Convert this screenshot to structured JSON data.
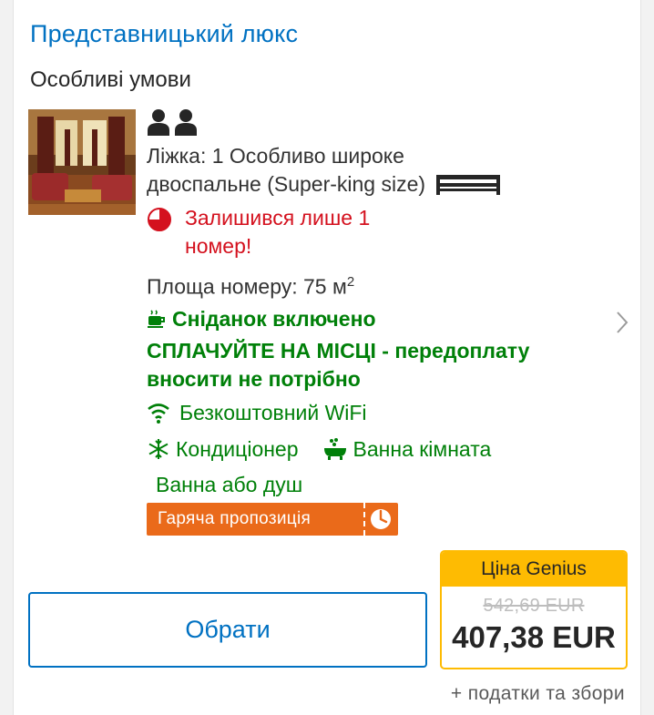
{
  "room": {
    "title": "Представницький люкс",
    "conditions": "Особливі умови",
    "beds_line1": "Ліжка: 1 Особливо широке",
    "beds_line2": "двоспальне (Super-king size)",
    "scarcity_line1": "Залишився лише 1",
    "scarcity_line2": "номер!",
    "area_label": "Площа номеру: 75 м",
    "area_sup": "2",
    "breakfast": "Сніданок включено",
    "pay_line1": "СПЛАЧУЙТЕ НА МІСЦІ - передоплату",
    "pay_line2": "вносити не потрібно",
    "wifi": "Безкоштовний WiFi",
    "ac": "Кондиціонер",
    "bathroom": "Ванна кімната",
    "bath_or_shower": "Ванна або душ",
    "hot_deal": "Гаряча пропозиція"
  },
  "action": {
    "select_label": "Обрати"
  },
  "price": {
    "genius_label": "Ціна Genius",
    "old_price": "542,69 EUR",
    "new_price": "407,38 EUR",
    "taxes": "+ податки та збори"
  },
  "colors": {
    "brand_blue": "#0071c2",
    "green": "#008009",
    "red": "#d4111e",
    "genius_yellow": "#febb02",
    "hot_orange": "#ea6a1a"
  },
  "icons": [
    "person-icon",
    "bed-icon",
    "clock-icon",
    "coffee-cup-icon",
    "wifi-icon",
    "snowflake-icon",
    "bathtub-icon",
    "hot-deal-clock-icon",
    "chevron-right-icon"
  ]
}
